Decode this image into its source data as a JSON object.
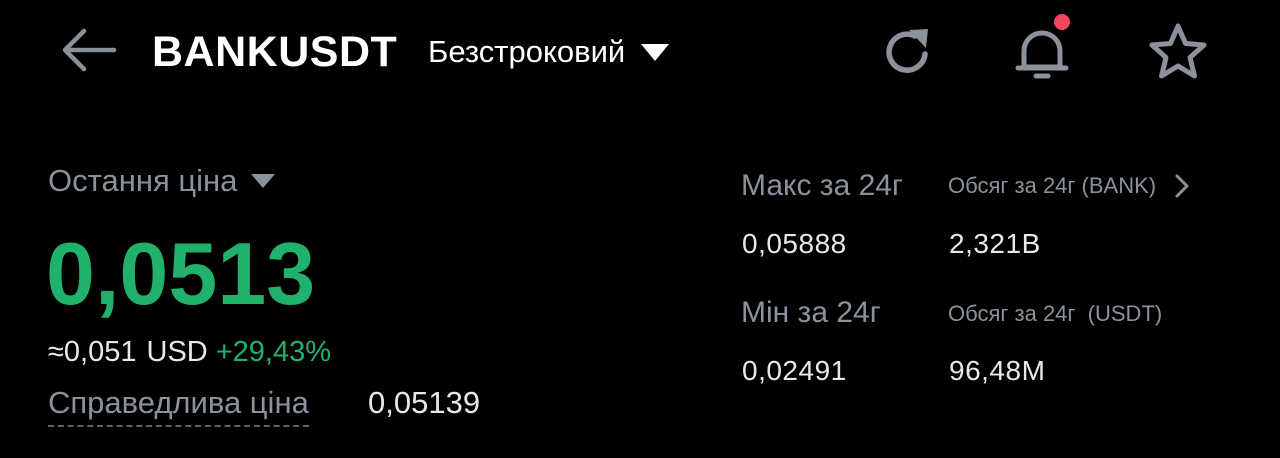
{
  "header": {
    "symbol": "BANKUSDT",
    "contract_type": "Безстроковий",
    "back_icon": "arrow-left-icon",
    "actions": [
      {
        "name": "refresh-icon"
      },
      {
        "name": "bell-icon",
        "has_notification": true
      },
      {
        "name": "star-icon"
      }
    ]
  },
  "price": {
    "label": "Остання ціна",
    "value": "0,0513",
    "usd_approx": "≈0,051",
    "usd_unit": "USD",
    "change": "+29,43%",
    "fair_label": "Справедлива ціна",
    "fair_value": "0,05139"
  },
  "stats": {
    "high_label": "Макс за 24г",
    "high_value": "0,05888",
    "low_label": "Мін за 24г",
    "low_value": "0,02491",
    "vol_base_label": "Обсяг за 24г (BANK)",
    "vol_base_value": "2,321B",
    "vol_quote_label": "Обсяг за 24г  (USDT)",
    "vol_quote_value": "96,48M"
  },
  "colors": {
    "background": "#000000",
    "positive": "#20b26c",
    "muted": "#8b929b",
    "text": "#e6e8ea",
    "notification": "#f6465d"
  }
}
